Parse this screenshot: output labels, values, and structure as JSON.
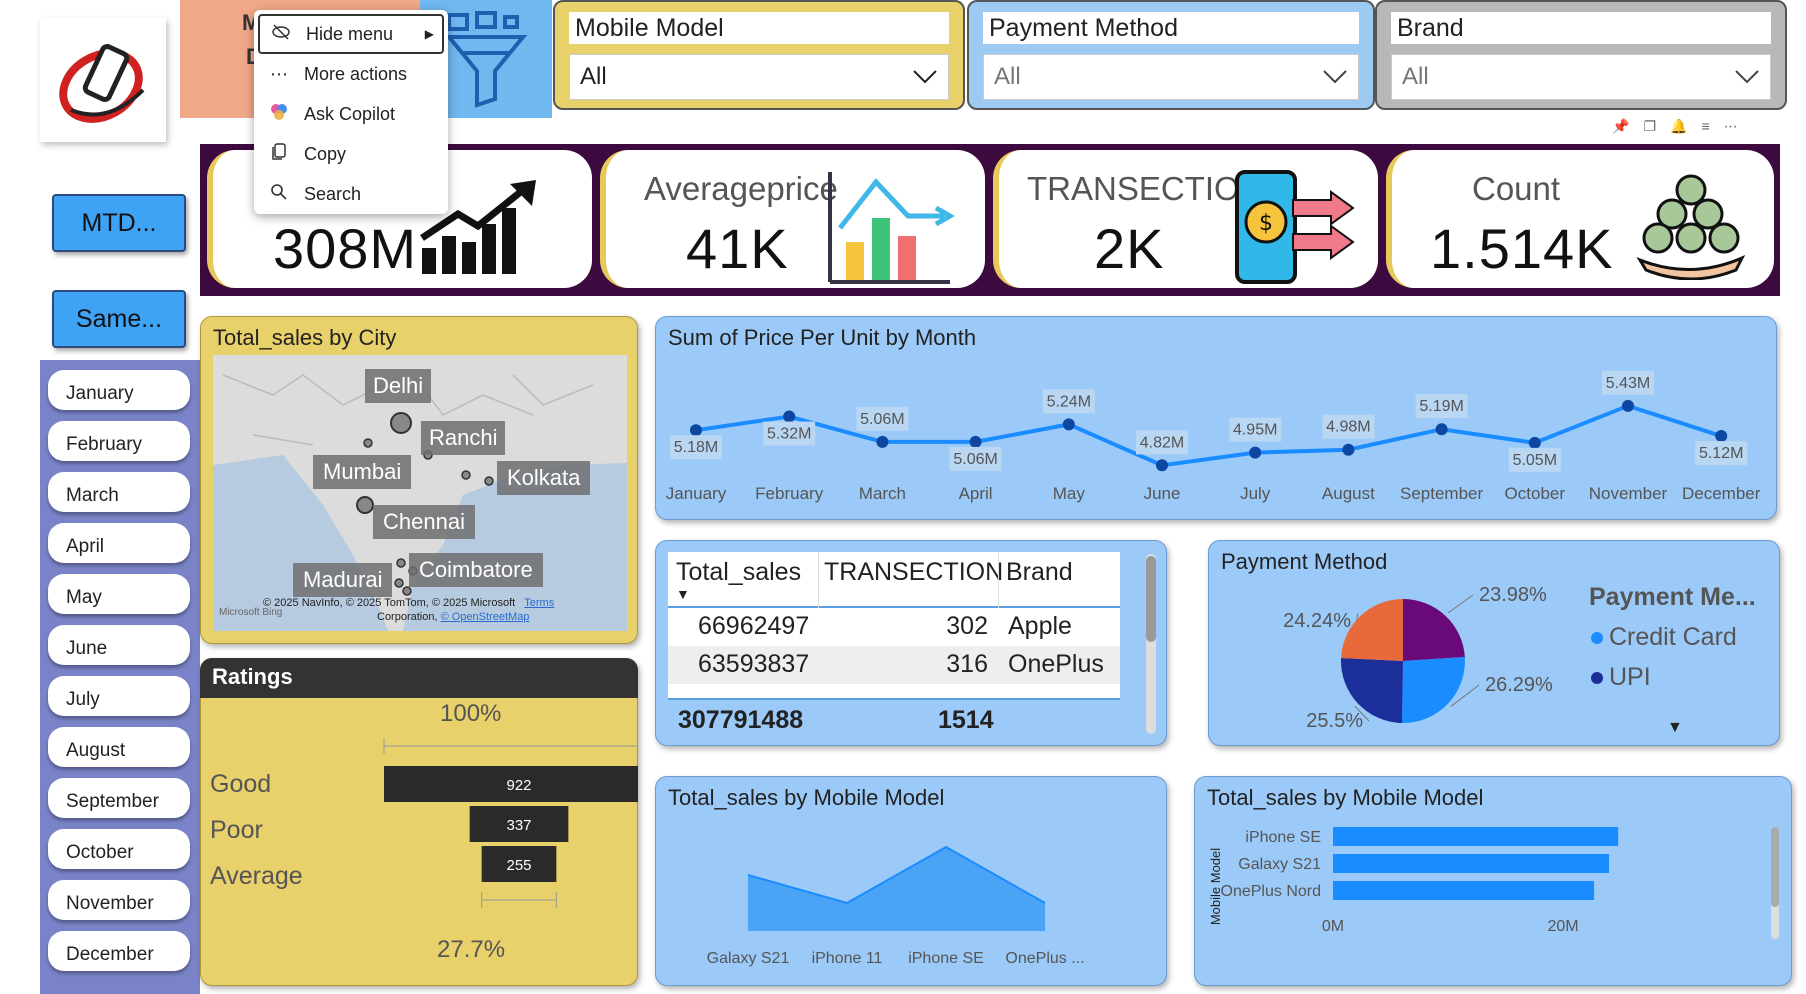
{
  "context_menu": {
    "items": [
      {
        "label": "Hide menu",
        "icon": "eye-off-icon"
      },
      {
        "label": "More actions",
        "icon": "ellipsis-icon"
      },
      {
        "label": "Ask Copilot",
        "icon": "copilot-icon"
      },
      {
        "label": "Copy",
        "icon": "copy-icon"
      },
      {
        "label": "Search",
        "icon": "search-icon"
      }
    ]
  },
  "slicers": {
    "mobile_model": {
      "title": "Mobile Model",
      "value": "All"
    },
    "payment_method": {
      "title": "Payment Method",
      "value": "All"
    },
    "brand": {
      "title": "Brand",
      "value": "All"
    }
  },
  "kpis": [
    {
      "label": "",
      "value": "308M"
    },
    {
      "label": "Averageprice",
      "value": "41K"
    },
    {
      "label": "TRANSECTION",
      "value": "2K"
    },
    {
      "label": "Count",
      "value": "1.514K"
    }
  ],
  "buttons": {
    "mtd": "MTD...",
    "same": "Same..."
  },
  "months": [
    "January",
    "February",
    "March",
    "April",
    "May",
    "June",
    "July",
    "August",
    "September",
    "October",
    "November",
    "December"
  ],
  "map": {
    "title": "Total_sales by City",
    "cities": [
      "Delhi",
      "Ranchi",
      "Mumbai",
      "Kolkata",
      "Chennai",
      "Madurai",
      "Coimbatore"
    ],
    "attribution_1": "© 2025 NavInfo, © 2025 TomTom, © 2025 Microsoft",
    "attribution_terms": "Terms",
    "attribution_2": "Corporation,",
    "attribution_osm": "© OpenStreetMap",
    "bing": "Microsoft Bing"
  },
  "ratings": {
    "title": "Ratings",
    "top_pct": "100%",
    "bottom_pct": "27.7%",
    "labels": [
      "Good",
      "Poor",
      "Average"
    ],
    "values": [
      "922",
      "337",
      "255"
    ]
  },
  "line_chart": {
    "title": "Sum of Price Per Unit by Month",
    "months": [
      "January",
      "February",
      "March",
      "April",
      "May",
      "June",
      "July",
      "August",
      "September",
      "October",
      "November",
      "December"
    ],
    "labels": [
      "5.18M",
      "5.32M",
      "5.06M",
      "5.06M",
      "5.24M",
      "4.82M",
      "4.95M",
      "4.98M",
      "5.19M",
      "5.05M",
      "5.43M",
      "5.12M"
    ]
  },
  "table": {
    "headers": [
      "Total_sales",
      "TRANSECTION",
      "Brand"
    ],
    "rows": [
      [
        "66962497",
        "302",
        "Apple"
      ],
      [
        "63593837",
        "316",
        "OnePlus"
      ]
    ],
    "total": [
      "307791488",
      "1514"
    ]
  },
  "pie": {
    "title": "Payment Method",
    "legend_title": "Payment Me...",
    "legend": [
      "Credit Card",
      "UPI"
    ],
    "labels": [
      "23.98%",
      "26.29%",
      "25.5%",
      "24.24%"
    ]
  },
  "area": {
    "title": "Total_sales by Mobile Model",
    "categories": [
      "Galaxy S21",
      "iPhone 11",
      "iPhone SE",
      "OnePlus ..."
    ]
  },
  "hbar": {
    "title": "Total_sales by Mobile Model",
    "axis_title": "Mobile Model",
    "categories": [
      "iPhone SE",
      "Galaxy S21",
      "OnePlus Nord"
    ],
    "ticks": [
      "0M",
      "20M"
    ]
  },
  "chart_data": [
    {
      "type": "line",
      "title": "Sum of Price Per Unit by Month",
      "categories": [
        "January",
        "February",
        "March",
        "April",
        "May",
        "June",
        "July",
        "August",
        "September",
        "October",
        "November",
        "December"
      ],
      "values": [
        5.18,
        5.32,
        5.06,
        5.06,
        5.24,
        4.82,
        4.95,
        4.98,
        5.19,
        5.05,
        5.43,
        5.12
      ],
      "unit": "M"
    },
    {
      "type": "pie",
      "title": "Payment Method",
      "categories": [
        "Credit Card",
        "UPI"
      ],
      "values": [
        23.98,
        26.29,
        25.5,
        24.24
      ],
      "colors": [
        "#6a0a7a",
        "#1a8cff",
        "#1c2e9a",
        "#e8693a"
      ]
    },
    {
      "type": "bar",
      "title": "Ratings",
      "categories": [
        "Good",
        "Poor",
        "Average"
      ],
      "values": [
        922,
        337,
        255
      ]
    },
    {
      "type": "area",
      "title": "Total_sales by Mobile Model",
      "categories": [
        "Galaxy S21",
        "iPhone 11",
        "iPhone SE",
        "OnePlus ..."
      ],
      "values": [
        10,
        5,
        15,
        5
      ]
    },
    {
      "type": "bar",
      "title": "Total_sales by Mobile Model",
      "categories": [
        "iPhone SE",
        "Galaxy S21",
        "OnePlus Nord"
      ],
      "values": [
        24.8,
        24.0,
        22.7
      ],
      "unit": "M"
    }
  ]
}
